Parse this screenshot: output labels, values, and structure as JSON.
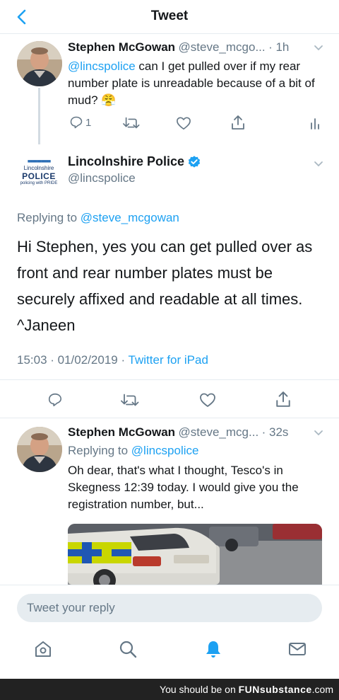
{
  "header": {
    "title": "Tweet"
  },
  "tweet1": {
    "name": "Stephen McGowan",
    "handle": "@steve_mcgo...",
    "time": "· 1h",
    "mention": "@lincspolice",
    "text": " can I get pulled over if my rear number plate is unreadable because of a bit of mud? 😤",
    "reply_count": "1"
  },
  "tweet2": {
    "logo_top": "Lincolnshire",
    "logo_main": "POLICE",
    "logo_sub": "policing with PRIDE",
    "name": "Lincolnshire Police",
    "handle": "@lincspolice",
    "replying_prefix": "Replying to ",
    "replying_handle": "@steve_mcgowan",
    "text": "Hi Stephen, yes you can get pulled over as front and rear number plates must be securely affixed and readable at all times. ^Janeen",
    "timestamp": "15:03 · 01/02/2019 · ",
    "source": "Twitter for iPad"
  },
  "tweet3": {
    "name": "Stephen McGowan",
    "handle": "@steve_mcg...",
    "time": "· 32s",
    "replying_prefix": "Replying to ",
    "replying_handle": "@lincspolice",
    "text": "Oh dear, that's what I thought, Tesco's in Skegness 12:39 today. I would give you the registration number, but..."
  },
  "reply": {
    "placeholder": "Tweet your reply"
  },
  "footer": {
    "prefix": "You should be on ",
    "brand": "FUNsubstance",
    "suffix": ".com"
  },
  "colors": {
    "accent": "#1da1f2",
    "secondary_text": "#657786",
    "divider": "#e6ecf0"
  },
  "icons": [
    "back-arrow-icon",
    "reply-icon",
    "retweet-icon",
    "like-icon",
    "share-icon",
    "analytics-icon",
    "verified-badge-icon",
    "home-icon",
    "search-icon",
    "notifications-icon",
    "messages-icon"
  ]
}
